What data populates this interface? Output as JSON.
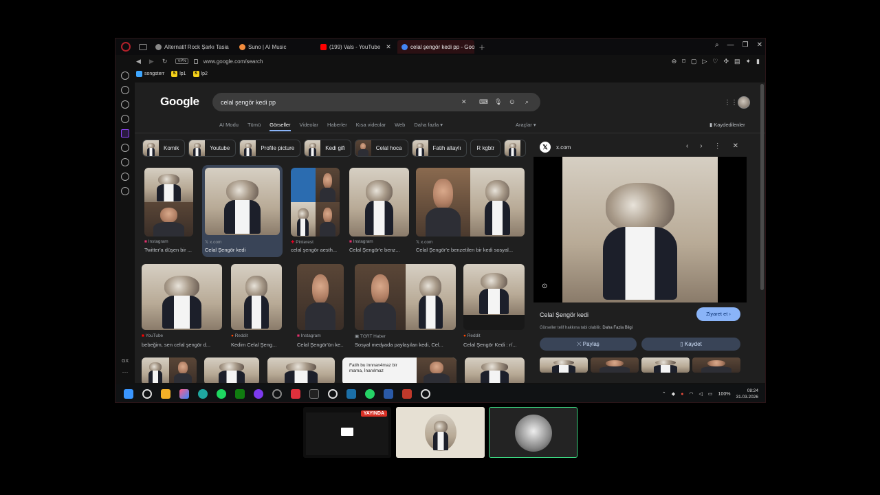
{
  "browser": {
    "tabs": [
      {
        "label": "Alternatif Rock Şarkı Tasia",
        "color": "#888888",
        "active": false
      },
      {
        "label": "Suno | AI Music",
        "color": "#f28b3c",
        "active": false
      },
      {
        "label": "(199) Vals - YouTube",
        "color": "#ff0000",
        "active": false
      },
      {
        "label": "celal şengör kedi pp - Goo",
        "color": "#4285f4",
        "active": true
      }
    ],
    "vpn_label": "VPN",
    "url": "www.google.com/search",
    "bookmarks": [
      {
        "label": "songsterr",
        "color": "#3ea6ff",
        "badge": ""
      },
      {
        "label": "lp1",
        "color": "#f6d21a",
        "badge": "S"
      },
      {
        "label": "lp2",
        "color": "#f6d21a",
        "badge": "S"
      }
    ],
    "sidebar_label": "GX",
    "sidebar_more": "···"
  },
  "google": {
    "logo": "Google",
    "query": "celal şengör kedi pp",
    "filters": [
      "AI Modu",
      "Tümü",
      "Görseller",
      "Videolar",
      "Haberler",
      "Kısa videolar",
      "Web",
      "Daha fazla ▾"
    ],
    "active_filter": "Görseller",
    "tools": "Araçlar ▾",
    "saved": "Kaydedilenler",
    "chips": [
      "Komik",
      "Youtube",
      "Profile picture",
      "Kedi gifi",
      "Celal hoca",
      "Fatih altaylı",
      "R kgbtr"
    ],
    "results": [
      {
        "source": "Instagram",
        "caption": "Twitter'a düşen bir ..."
      },
      {
        "source": "x.com",
        "caption": "Celal Şengör kedi"
      },
      {
        "source": "Pinterest",
        "caption": "celal şengör aesth..."
      },
      {
        "source": "Instagram",
        "caption": "Celal Şengör'e benz..."
      },
      {
        "source": "x.com",
        "caption": "Celal Şengör'e benzetilen bir kedi sosyal..."
      },
      {
        "source": "YouTube",
        "caption": "bebeğim, sen celal şengör d..."
      },
      {
        "source": "Reddit",
        "caption": "Kedim Celal Şeng..."
      },
      {
        "source": "Instagram",
        "caption": "Celal Şengör'ün ke..."
      },
      {
        "source": "TGRT Haber",
        "caption": "Sosyal medyada paylaşılan kedi, Cel..."
      },
      {
        "source": "Reddit",
        "caption": "Celal Şengör Kedi : r/..."
      }
    ],
    "row3_overlay": "Fatih bu innnan4maz bir mama, İnanılmaz",
    "preview": {
      "site": "x.com",
      "title": "Celal Şengör kedi",
      "visit": "Ziyaret et ›",
      "note_prefix": "Görseller telif hakkına tabi olabilir.",
      "note_link": "Daha Fazla Bilgi",
      "share": "Paylaş",
      "save": "Kaydet"
    }
  },
  "taskbar": {
    "battery": "100%",
    "time": "08:24",
    "date": "31.03.2026"
  },
  "meeting": {
    "live_badge": "YAYINDA"
  }
}
